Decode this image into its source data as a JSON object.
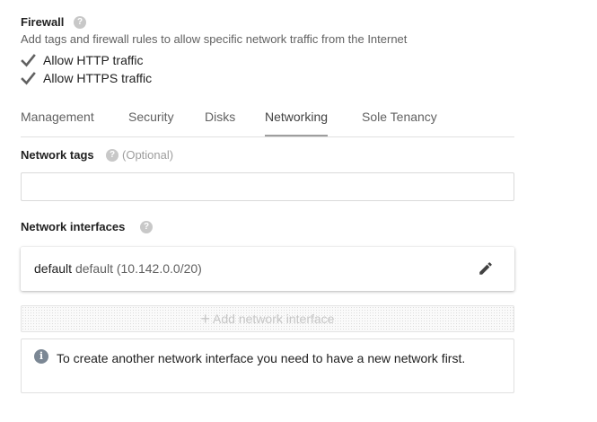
{
  "firewall": {
    "title": "Firewall",
    "help_icon": "help-icon",
    "description": "Add tags and firewall rules to allow specific network traffic from the Internet",
    "options": [
      {
        "label": "Allow HTTP traffic",
        "checked": true
      },
      {
        "label": "Allow HTTPS traffic",
        "checked": true
      }
    ]
  },
  "tabs": [
    {
      "label": "Management",
      "active": false
    },
    {
      "label": "Security",
      "active": false
    },
    {
      "label": "Disks",
      "active": false
    },
    {
      "label": "Networking",
      "active": true
    },
    {
      "label": "Sole Tenancy",
      "active": false
    }
  ],
  "network_tags": {
    "label": "Network tags",
    "optional_text": "(Optional)",
    "value": "",
    "placeholder": ""
  },
  "network_interfaces": {
    "label": "Network interfaces",
    "items": [
      {
        "name": "default",
        "detail": "default (10.142.0.0/20)",
        "action_icon": "edit-icon"
      }
    ],
    "add_button_label": "Add network interface",
    "add_button_enabled": false,
    "info_text": "To create another network interface you need to have a new network first."
  },
  "colors": {
    "checkbox": "#616161",
    "active_tab_underline": "#9e9e9e",
    "info_icon": "#7b8794"
  }
}
